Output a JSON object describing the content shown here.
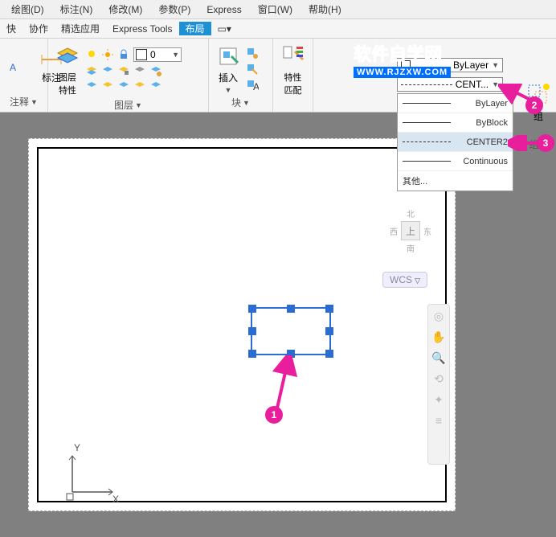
{
  "menu": {
    "draw": "绘图(D)",
    "annotate": "标注(N)",
    "modify": "修改(M)",
    "param": "参数(P)",
    "express": "Express",
    "window": "窗口(W)",
    "help": "帮助(H)"
  },
  "toolbar": {
    "quick": "快",
    "collab": "协作",
    "select": "精选应用",
    "et": "Express Tools",
    "layout": "布局",
    "lcolor": "0"
  },
  "panels": {
    "annotate": "注释",
    "layer": "图层\n特性",
    "layer_group": "图层",
    "insert": "插入",
    "block": "块",
    "props": "特性\n匹配",
    "group": "组",
    "group_txt": "组",
    "annotate_btn": "标注"
  },
  "linetype": {
    "bylayer": "ByLayer",
    "current": "CENT...",
    "opt1": "ByLayer",
    "opt2": "ByBlock",
    "opt3": "CENTER2",
    "opt4": "Continuous",
    "other": "其他..."
  },
  "view": {
    "top": "上",
    "n": "北",
    "s": "南",
    "w": "西",
    "e": "东",
    "wcs": "WCS"
  },
  "ucs": {
    "x": "X",
    "y": "Y"
  },
  "markers": {
    "m1": "1",
    "m2": "2",
    "m3": "3"
  },
  "watermark": {
    "cn": "软件自学网",
    "en": "WWW.RJZXW.COM"
  }
}
